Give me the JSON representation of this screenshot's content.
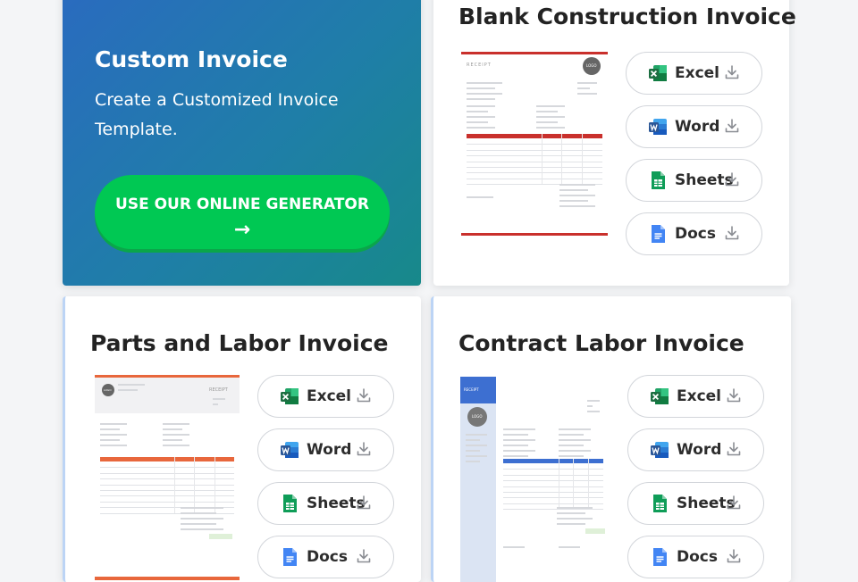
{
  "promo": {
    "title": "Custom Invoice",
    "description": "Create a Customized Invoice Template.",
    "button_label": "USE OUR ONLINE GENERATOR",
    "button_arrow": "→"
  },
  "cards": [
    {
      "title": "Blank Construction Invoice",
      "thumb_heading": "RECEIPT",
      "thumb_logo": "LOGO",
      "accent_color": "#c9302c",
      "buttons": [
        {
          "label": "Excel",
          "icon": "excel-icon"
        },
        {
          "label": "Word",
          "icon": "word-icon"
        },
        {
          "label": "Sheets",
          "icon": "sheets-icon"
        },
        {
          "label": "Docs",
          "icon": "docs-icon"
        }
      ]
    },
    {
      "title": "Parts and Labor Invoice",
      "thumb_heading": "RECEIPT",
      "thumb_logo": "LOGO",
      "accent_color": "#e8673c",
      "buttons": [
        {
          "label": "Excel",
          "icon": "excel-icon"
        },
        {
          "label": "Word",
          "icon": "word-icon"
        },
        {
          "label": "Sheets",
          "icon": "sheets-icon"
        },
        {
          "label": "Docs",
          "icon": "docs-icon"
        }
      ]
    },
    {
      "title": "Contract Labor Invoice",
      "thumb_heading": "RECEIPT",
      "thumb_logo": "LOGO",
      "accent_color": "#3d6fd1",
      "buttons": [
        {
          "label": "Excel",
          "icon": "excel-icon"
        },
        {
          "label": "Word",
          "icon": "word-icon"
        },
        {
          "label": "Sheets",
          "icon": "sheets-icon"
        },
        {
          "label": "Docs",
          "icon": "docs-icon"
        }
      ]
    }
  ],
  "colors": {
    "excel": "#1d6f42",
    "word": "#2b5797",
    "sheets": "#0f9d58",
    "docs": "#4285f4",
    "generator_button": "#00c853"
  }
}
